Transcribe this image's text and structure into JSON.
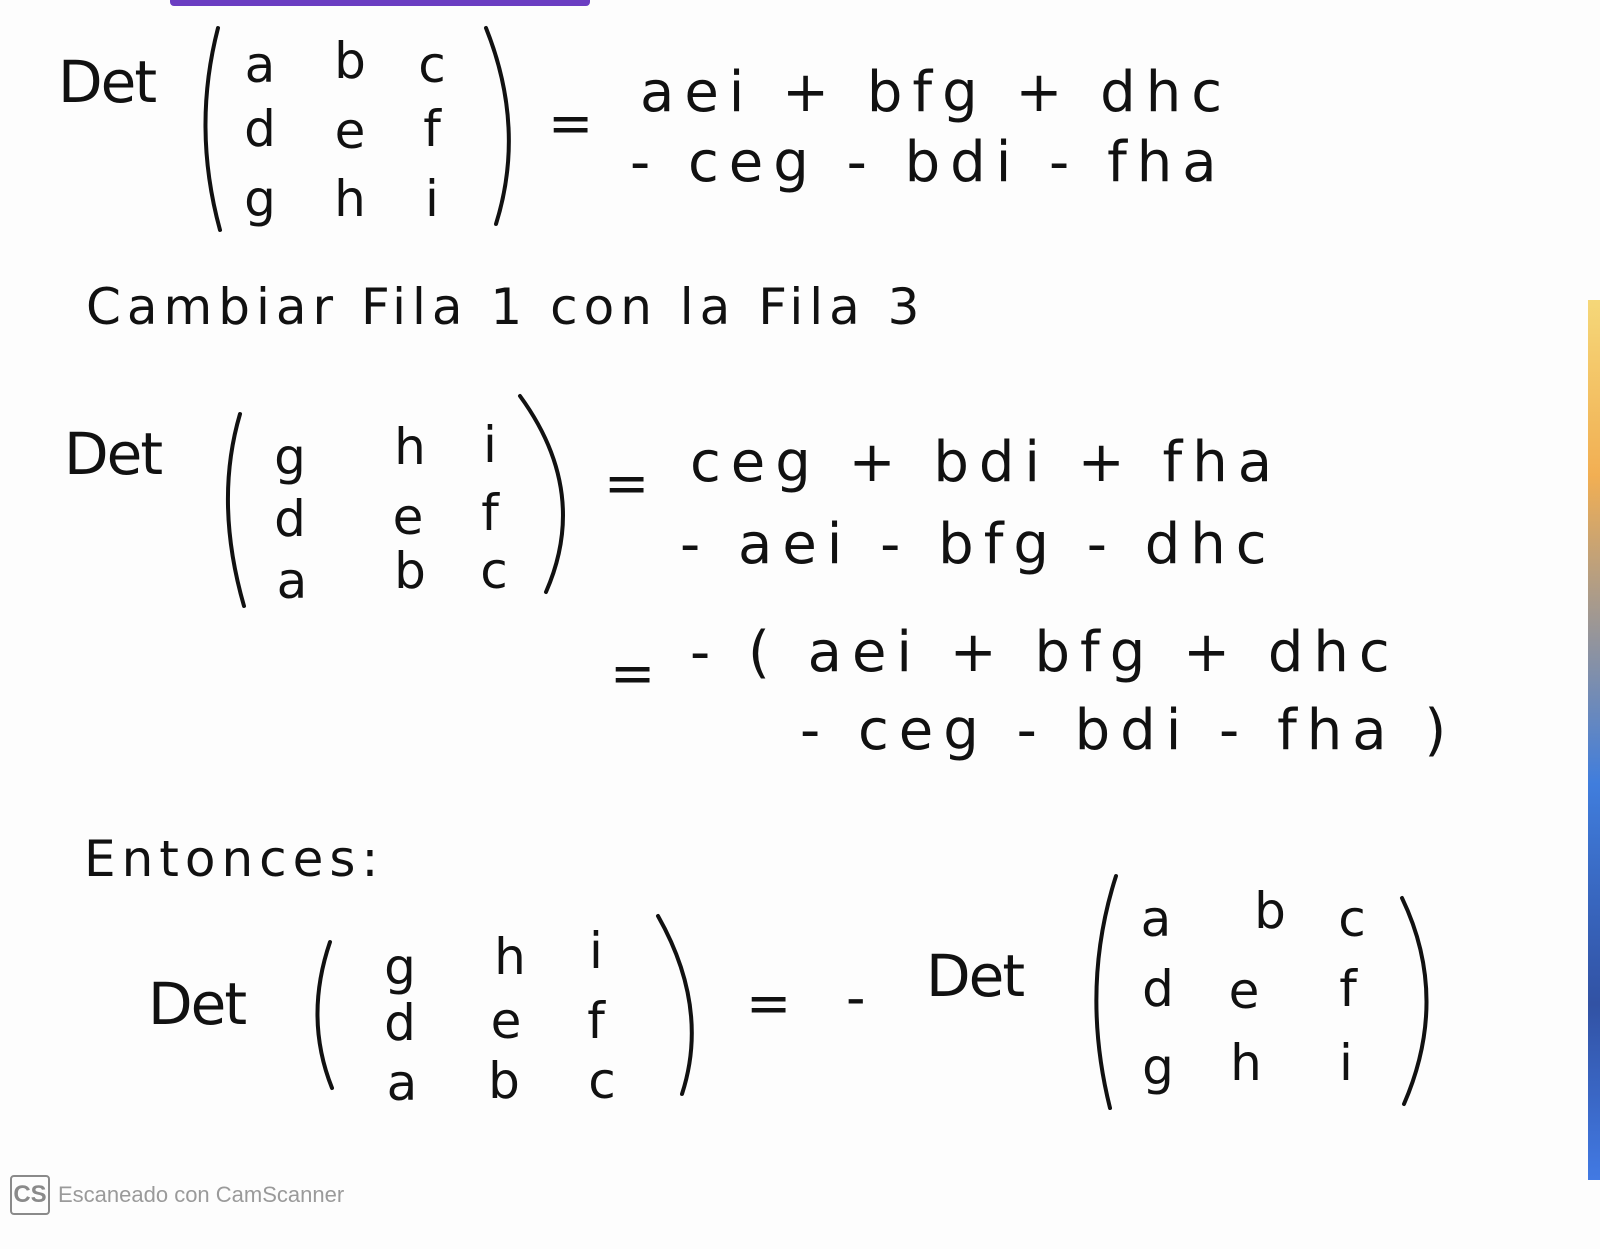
{
  "section1": {
    "det_label": "Det",
    "matrix": [
      [
        "a",
        "b",
        "c"
      ],
      [
        "d",
        "e",
        "f"
      ],
      [
        "g",
        "h",
        "i"
      ]
    ],
    "equals": "=",
    "rhs_line1": "aei + bfg + dhc",
    "rhs_line2": "- ceg - bdi - fha"
  },
  "instruction": "Cambiar Fila 1 con la Fila 3",
  "section2": {
    "det_label": "Det",
    "matrix": [
      [
        "g",
        "h",
        "i"
      ],
      [
        "d",
        "e",
        "f"
      ],
      [
        "a",
        "b",
        "c"
      ]
    ],
    "equals": "=",
    "rhs_line1": "ceg + bdi + fha",
    "rhs_line2": "- aei - bfg - dhc",
    "equals2": "=",
    "rhs_line3": "- ( aei + bfg + dhc",
    "rhs_line4": "- ceg - bdi - fha )"
  },
  "conclusion_label": "Entonces:",
  "section3": {
    "det_label_left": "Det",
    "matrix_left": [
      [
        "g",
        "h",
        "i"
      ],
      [
        "d",
        "e",
        "f"
      ],
      [
        "a",
        "b",
        "c"
      ]
    ],
    "equals": "=",
    "minus": "-",
    "det_label_right": "Det",
    "matrix_right": [
      [
        "a",
        "b",
        "c"
      ],
      [
        "d",
        "e",
        "f"
      ],
      [
        "g",
        "h",
        "i"
      ]
    ]
  },
  "footer": {
    "logo_text": "CS",
    "text": "Escaneado con CamScanner"
  }
}
